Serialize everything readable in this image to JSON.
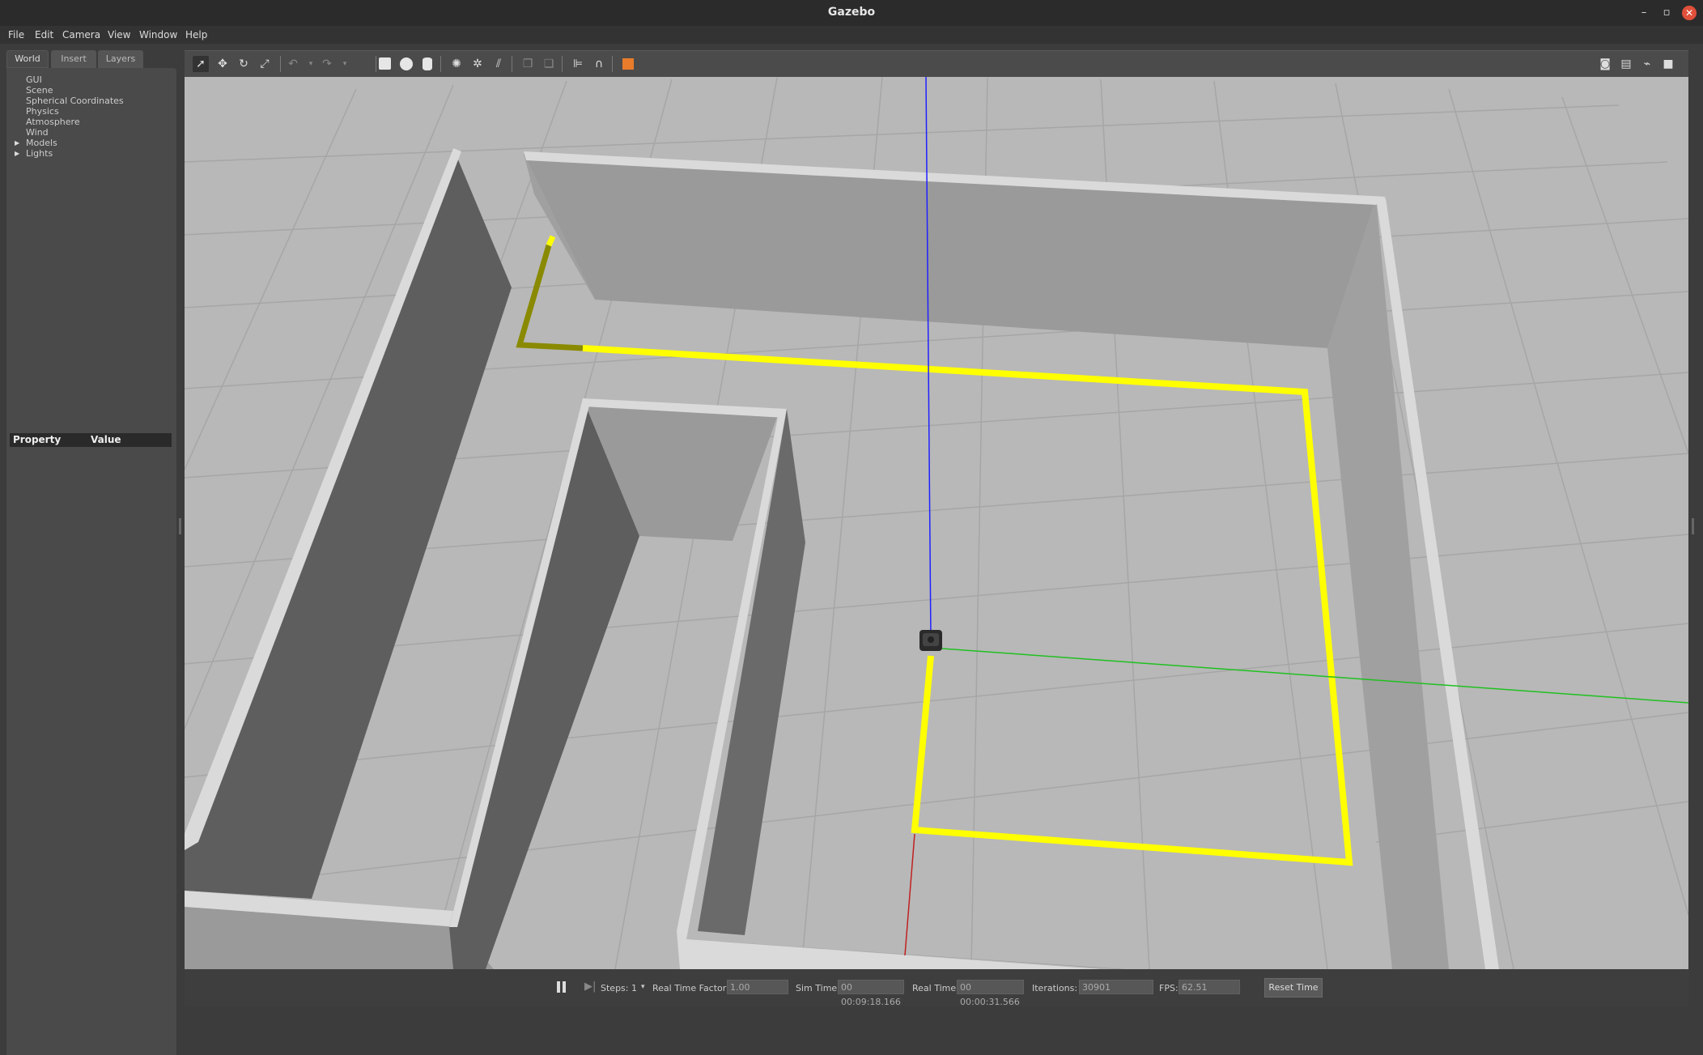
{
  "window": {
    "title": "Gazebo",
    "minimize": "–",
    "maximize": "▫",
    "close": "✕"
  },
  "menu": [
    "File",
    "Edit",
    "Camera",
    "View",
    "Window",
    "Help"
  ],
  "left_panel": {
    "tabs": [
      "World",
      "Insert",
      "Layers"
    ],
    "tree": [
      "GUI",
      "Scene",
      "Spherical Coordinates",
      "Physics",
      "Atmosphere",
      "Wind",
      "Models",
      "Lights"
    ],
    "property_header": {
      "property": "Property",
      "value": "Value"
    }
  },
  "toolbar": {
    "icons": [
      "select-arrow-icon",
      "translate-icon",
      "rotate-icon",
      "scale-icon",
      "undo-icon",
      "redo-icon",
      "box-icon",
      "sphere-icon",
      "cylinder-icon",
      "point-light-icon",
      "spot-light-icon",
      "directional-light-icon",
      "copy-icon",
      "paste-icon",
      "align-icon",
      "snap-icon",
      "view-angle-icon",
      "screenshot-icon",
      "log-icon",
      "plot-icon",
      "record-icon"
    ]
  },
  "bottom_bar": {
    "steps_label": "Steps:",
    "steps_value": "1",
    "rtf_label": "Real Time Factor:",
    "rtf_value": "1.00",
    "sim_time_label": "Sim Time:",
    "sim_time_value": "00 00:09:18.166",
    "real_time_label": "Real Time:",
    "real_time_value": "00 00:00:31.566",
    "iterations_label": "Iterations:",
    "iterations_value": "30901",
    "fps_label": "FPS:",
    "fps_value": "62.51",
    "reset_label": "Reset Time"
  },
  "colors": {
    "path": "#ffff00",
    "axis_z": "#2020ff",
    "axis_y": "#20c020",
    "axis_x": "#c02020",
    "wall_top": "#d9d9d9",
    "wall_side": "#5e5e5e",
    "ground": "#b8b8b8"
  }
}
